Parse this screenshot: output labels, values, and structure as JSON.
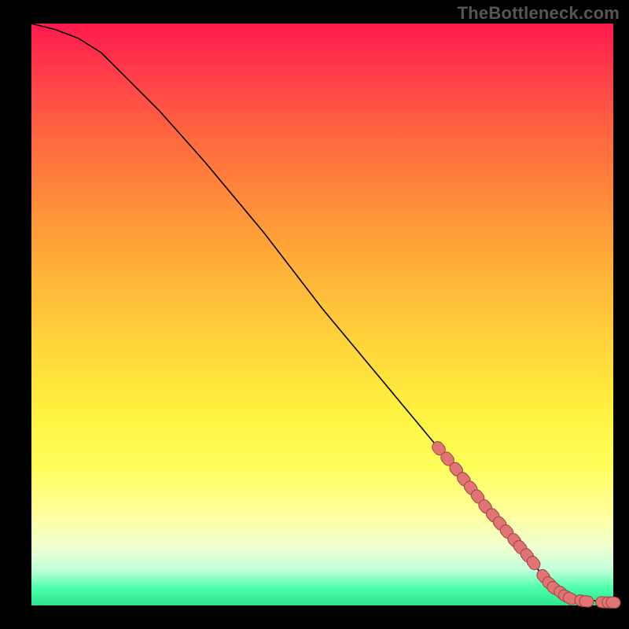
{
  "attribution": "TheBottleneck.com",
  "colors": {
    "page_bg": "#000000",
    "glyph_fill": "#e27474",
    "glyph_stroke": "#a04a4a",
    "curve": "#000000"
  },
  "chart_data": {
    "type": "line",
    "title": "",
    "xlabel": "",
    "ylabel": "",
    "xlim": [
      0,
      100
    ],
    "ylim": [
      0,
      100
    ],
    "grid": false,
    "series": [
      {
        "name": "curve",
        "x": [
          0,
          4,
          8,
          12,
          16,
          22,
          30,
          40,
          50,
          60,
          70,
          78,
          84,
          88,
          91,
          93,
          95,
          97,
          99,
          100
        ],
        "y": [
          100,
          99,
          97.5,
          95,
          91,
          85,
          76,
          64,
          51,
          39,
          27,
          17,
          10,
          5,
          2.5,
          1.5,
          1.0,
          0.8,
          0.6,
          0.5
        ]
      }
    ],
    "scatter_points": [
      {
        "x": 70.0,
        "y": 27.0
      },
      {
        "x": 71.5,
        "y": 25.2
      },
      {
        "x": 73.0,
        "y": 23.4
      },
      {
        "x": 74.3,
        "y": 21.7
      },
      {
        "x": 75.5,
        "y": 20.2
      },
      {
        "x": 76.7,
        "y": 18.7
      },
      {
        "x": 78.0,
        "y": 17.0
      },
      {
        "x": 79.3,
        "y": 15.5
      },
      {
        "x": 80.5,
        "y": 14.1
      },
      {
        "x": 81.7,
        "y": 12.7
      },
      {
        "x": 83.0,
        "y": 11.2
      },
      {
        "x": 84.0,
        "y": 10.0
      },
      {
        "x": 85.2,
        "y": 8.6
      },
      {
        "x": 86.3,
        "y": 7.3
      },
      {
        "x": 88.0,
        "y": 5.0
      },
      {
        "x": 89.0,
        "y": 3.8
      },
      {
        "x": 89.8,
        "y": 3.0
      },
      {
        "x": 91.0,
        "y": 2.2
      },
      {
        "x": 91.8,
        "y": 1.6
      },
      {
        "x": 92.6,
        "y": 1.2
      },
      {
        "x": 94.6,
        "y": 0.8
      },
      {
        "x": 95.4,
        "y": 0.7
      },
      {
        "x": 98.2,
        "y": 0.55
      },
      {
        "x": 99.3,
        "y": 0.5
      },
      {
        "x": 100.0,
        "y": 0.5
      }
    ]
  }
}
